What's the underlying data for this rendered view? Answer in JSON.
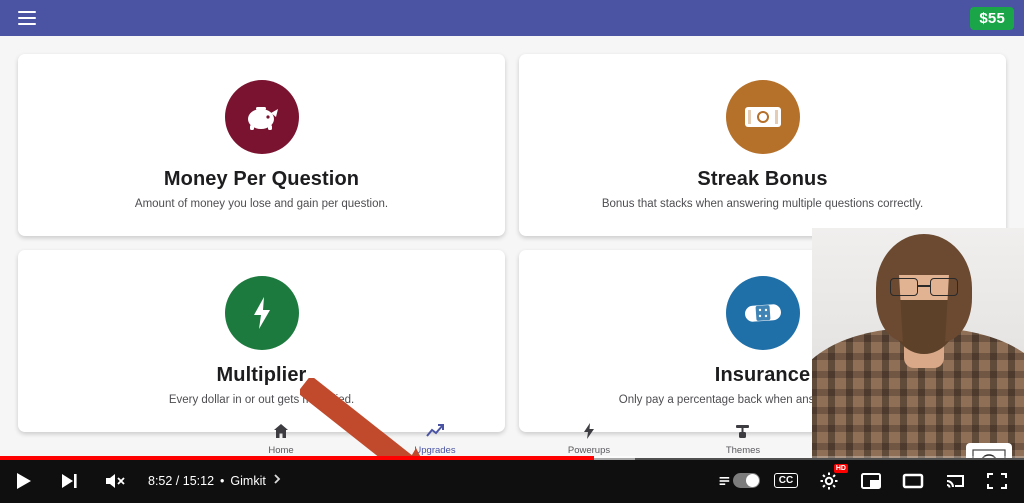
{
  "topbar": {
    "menu_icon": "hamburger-icon",
    "money": "$55",
    "bg_color": "#4a54a3",
    "money_color": "#1aa548"
  },
  "upgrades": [
    {
      "id": "money-per-question",
      "title": "Money Per Question",
      "desc": "Amount of money you lose and gain per question.",
      "icon": "piggy-bank-icon",
      "color": "#7a1330"
    },
    {
      "id": "streak-bonus",
      "title": "Streak Bonus",
      "desc": "Bonus that stacks when answering multiple questions correctly.",
      "icon": "cash-icon",
      "color": "#b5702a"
    },
    {
      "id": "multiplier",
      "title": "Multiplier",
      "desc": "Every dollar in or out gets multiplied.",
      "icon": "lightning-bolt-icon",
      "color": "#1d7a3e"
    },
    {
      "id": "insurance",
      "title": "Insurance",
      "desc": "Only pay a percentage back when answering incorrectly.",
      "icon": "bandage-icon",
      "color": "#1f6fa8"
    }
  ],
  "game_nav": [
    {
      "id": "home",
      "label": "Home",
      "icon": "home-icon",
      "active": false
    },
    {
      "id": "upgrades",
      "label": "Upgrades",
      "icon": "chart-up-icon",
      "active": true
    },
    {
      "id": "powerups",
      "label": "Powerups",
      "icon": "lightning-icon",
      "active": false
    },
    {
      "id": "themes",
      "label": "Themes",
      "icon": "paint-roller-icon",
      "active": false
    }
  ],
  "annotation": {
    "arrow": "red-arrow-annotation",
    "color": "#c04a2b"
  },
  "player": {
    "play_icon": "play-icon",
    "next_icon": "next-video-icon",
    "mute_icon": "muted-volume-icon",
    "time": "8:52 / 15:12",
    "separator": "•",
    "chapter": "Gimkit",
    "chapter_chevron": "chevron-right-icon",
    "autoplay_icon": "autoplay-toggle",
    "cc_label": "CC",
    "settings_icon": "gear-icon",
    "hd_badge": "HD",
    "miniplayer_icon": "miniplayer-icon",
    "theater_icon": "theater-mode-icon",
    "cast_icon": "cast-icon",
    "fullscreen_icon": "fullscreen-icon",
    "progress_played_percent": 58,
    "progress_buffered_percent": 62,
    "played_color": "#ff0000"
  },
  "webcam": {
    "label": "presenter-webcam-overlay",
    "logo": "tree-logo-watermark"
  }
}
